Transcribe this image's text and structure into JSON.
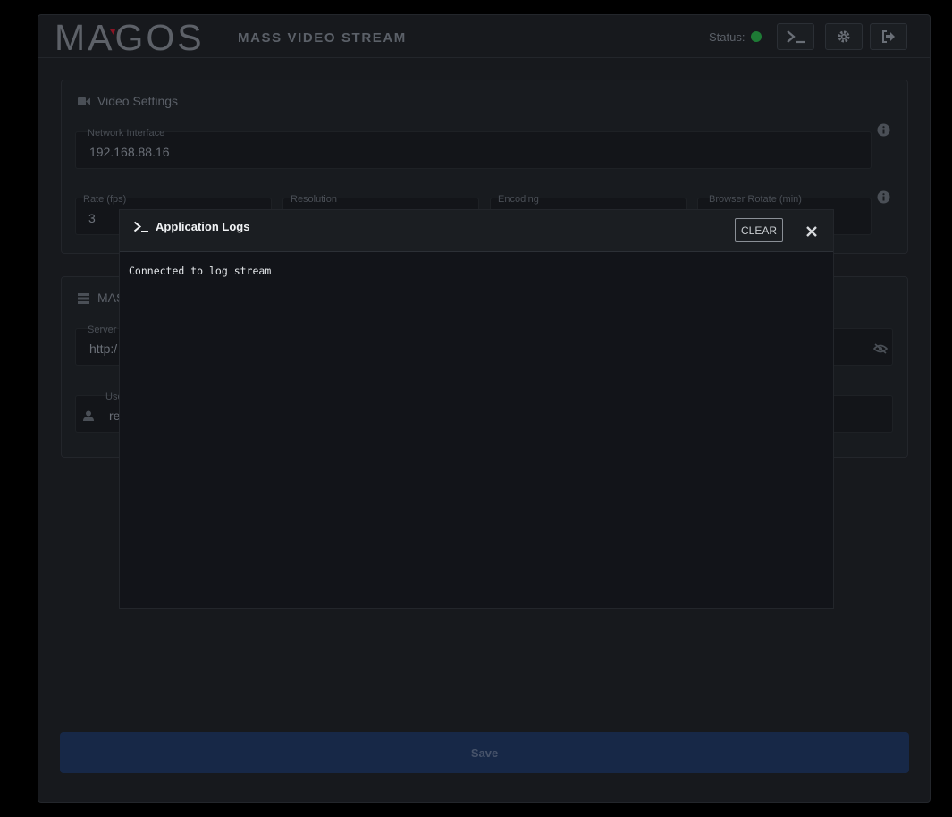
{
  "header": {
    "logo_text": "MAGOS",
    "subtitle": "MASS VIDEO STREAM",
    "status_label": "Status:",
    "status_color": "#1e7a35",
    "buttons": [
      {
        "icon": "terminal-icon"
      },
      {
        "icon": "gear-icon"
      },
      {
        "icon": "logout-icon"
      }
    ]
  },
  "video_settings": {
    "title": "Video Settings",
    "network_interface": {
      "label": "Network Interface",
      "value": "192.168.88.16"
    },
    "rate": {
      "label": "Rate (fps)",
      "value": "3"
    },
    "resolution": {
      "label": "Resolution"
    },
    "encoding": {
      "label": "Encoding"
    },
    "browser_rotate": {
      "label": "Browser Rotate (min)"
    }
  },
  "mass_settings": {
    "title": "MAS",
    "server": {
      "label": "Server",
      "value": "http:/"
    },
    "username": {
      "label": "Use",
      "value": "re"
    }
  },
  "save_label": "Save",
  "modal": {
    "title": "Application Logs",
    "clear_label": "CLEAR",
    "close_label": "×",
    "logs": [
      "Connected to log stream"
    ]
  },
  "colors": {
    "accent": "#172847",
    "brand_red": "#b0162a"
  }
}
